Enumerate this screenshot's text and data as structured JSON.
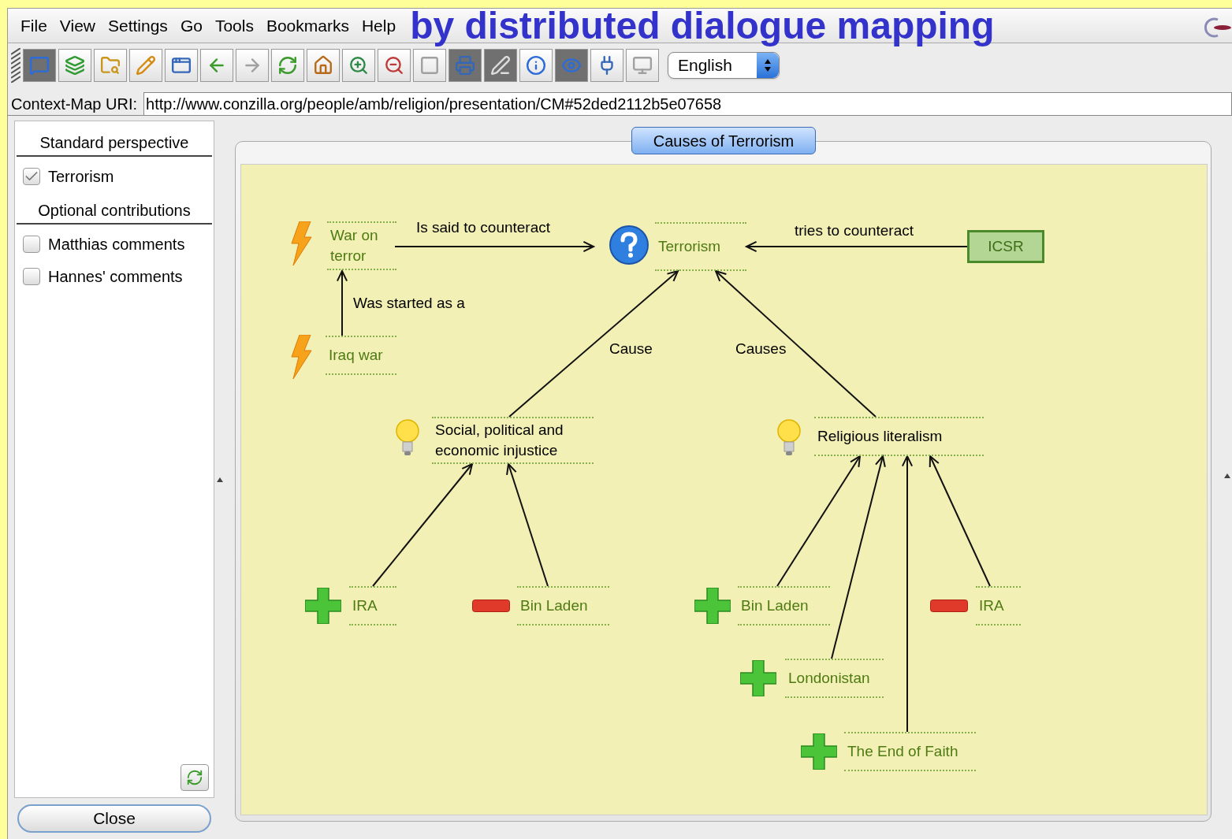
{
  "menu": [
    "File",
    "View",
    "Settings",
    "Go",
    "Tools",
    "Bookmarks",
    "Help"
  ],
  "overlay_caption": "by distributed dialogue mapping",
  "toolbar": [
    {
      "kind": "chat",
      "pressed": true,
      "disabled": false
    },
    {
      "kind": "layers",
      "pressed": false,
      "disabled": false
    },
    {
      "kind": "folder",
      "pressed": false,
      "disabled": false
    },
    {
      "kind": "pencil",
      "pressed": false,
      "disabled": false
    },
    {
      "kind": "new-window",
      "pressed": false,
      "disabled": false
    },
    {
      "kind": "back",
      "pressed": false,
      "disabled": false
    },
    {
      "kind": "forward",
      "pressed": false,
      "disabled": true
    },
    {
      "kind": "reload",
      "pressed": false,
      "disabled": false
    },
    {
      "kind": "home",
      "pressed": false,
      "disabled": false
    },
    {
      "kind": "zoom-in",
      "pressed": false,
      "disabled": false
    },
    {
      "kind": "zoom-out",
      "pressed": false,
      "disabled": false
    },
    {
      "kind": "box",
      "pressed": false,
      "disabled": true
    },
    {
      "kind": "print",
      "pressed": true,
      "disabled": false
    },
    {
      "kind": "pen",
      "pressed": true,
      "disabled": false
    },
    {
      "kind": "info",
      "pressed": false,
      "disabled": false
    },
    {
      "kind": "eye",
      "pressed": true,
      "disabled": false
    },
    {
      "kind": "plug",
      "pressed": false,
      "disabled": false
    },
    {
      "kind": "monitor",
      "pressed": false,
      "disabled": true
    }
  ],
  "language": "English",
  "uri": {
    "label": "Context-Map URI:",
    "value": "http://www.conzilla.org/people/amb/religion/presentation/CM#52ded2112b5e07658"
  },
  "sidebar": {
    "sections": [
      {
        "title": "Standard perspective",
        "items": [
          {
            "label": "Terrorism",
            "checked": true
          }
        ]
      },
      {
        "title": "Optional contributions",
        "items": [
          {
            "label": "Matthias comments",
            "checked": false
          },
          {
            "label": "Hannes' comments",
            "checked": false
          }
        ]
      }
    ],
    "close_button": "Close"
  },
  "map": {
    "title": "Causes of Terrorism",
    "nodes": [
      {
        "kind": "event",
        "text": "War on terror"
      },
      {
        "kind": "event",
        "text": "Iraq war"
      },
      {
        "kind": "question",
        "text": "Terrorism"
      },
      {
        "kind": "organization",
        "text": "ICSR"
      },
      {
        "kind": "position",
        "text": "Social, political and economic injustice"
      },
      {
        "kind": "position",
        "text": "Religious literalism"
      },
      {
        "kind": "pro",
        "text": "IRA"
      },
      {
        "kind": "con",
        "text": "Bin Laden"
      },
      {
        "kind": "pro",
        "text": "Bin Laden"
      },
      {
        "kind": "con",
        "text": "IRA"
      },
      {
        "kind": "pro",
        "text": "Londonistan"
      },
      {
        "kind": "pro",
        "text": "The End of Faith"
      }
    ],
    "link_labels": [
      "Is said to counteract",
      "tries to counteract",
      "Was started as a",
      "Cause",
      "Causes"
    ]
  }
}
